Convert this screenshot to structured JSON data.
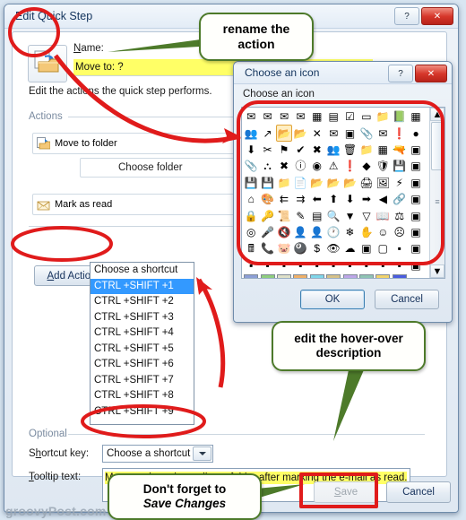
{
  "main_dialog": {
    "title": "Edit Quick Step",
    "help_button": "?",
    "close_button": "✕",
    "name_label": "Name:",
    "name_value": "Move to: ?",
    "description": "Edit the actions the quick step performs.",
    "actions_group": "Actions",
    "actions": [
      {
        "label": "Move to folder",
        "icon": "move-to-folder-icon",
        "sub_label": "Choose folder"
      },
      {
        "label": "Mark as read",
        "icon": "mark-as-read-icon"
      }
    ],
    "add_action_label": "Add Action",
    "optional_group": "Optional",
    "shortcut_label": "Shortcut key:",
    "shortcut_value": "Choose a shortcut",
    "tooltip_label": "Tooltip text:",
    "tooltip_value": "Moves selected e-mail to a folder after marking the e-mail as read.",
    "save_label": "Save",
    "save_disabled": true,
    "cancel_label": "Cancel"
  },
  "shortcut_dropdown": {
    "options": [
      "Choose a shortcut",
      "CTRL +SHIFT +1",
      "CTRL +SHIFT +2",
      "CTRL +SHIFT +3",
      "CTRL +SHIFT +4",
      "CTRL +SHIFT +5",
      "CTRL +SHIFT +6",
      "CTRL +SHIFT +7",
      "CTRL +SHIFT +8",
      "CTRL +SHIFT +9"
    ],
    "selected": "CTRL +SHIFT +1",
    "selected_index": 1,
    "highlight_color": "#3399ff"
  },
  "icon_dialog": {
    "title": "Choose an icon",
    "help_button": "?",
    "close_button": "✕",
    "prompt": "Choose an icon",
    "ok_label": "OK",
    "cancel_label": "Cancel",
    "selected_index": 13,
    "columns": 11,
    "icons": [
      "✉",
      "✉",
      "✉",
      "✉",
      "▦",
      "▤",
      "☑",
      "▭",
      "📁",
      "📗",
      "▦",
      "👥",
      "↗",
      "📂",
      "📂",
      "✕",
      "✉",
      "▣",
      "📎",
      "✉",
      "❗",
      "●",
      "⬇",
      "✂",
      "⚑",
      "✔",
      "✖",
      "👥",
      "🗑",
      "📁",
      "▦",
      "🔫",
      "▣",
      "📎",
      "⛬",
      "✖",
      "ⓘ",
      "◉",
      "⚠",
      "❗",
      "◆",
      "🛡",
      "💾",
      "▣",
      "💾",
      "💾",
      "📁",
      "📄",
      "📂",
      "📂",
      "📂",
      "🖨",
      "🖼",
      "⚡",
      "▣",
      "⌂",
      "🎨",
      "⇇",
      "⇉",
      "⬅",
      "⬆",
      "⬇",
      "➡",
      "◀",
      "🔗",
      "▣",
      "🔒",
      "🔑",
      "📜",
      "✎",
      "▤",
      "🔍",
      "▼",
      "▽",
      "📖",
      "⚖",
      "▣",
      "◎",
      "🎤",
      "🔇",
      "👤",
      "👤",
      "🕐",
      "❄",
      "✋",
      "☺",
      "☹",
      "▣",
      "🖩",
      "📞",
      "🐷",
      "🎱",
      "$",
      "👁",
      "☁",
      "▣",
      "▢",
      "▪",
      "▣",
      "▪",
      "▪",
      "▪",
      "▪",
      "▪",
      "▪",
      "▪",
      "▪",
      "▪",
      "▪",
      "▣"
    ],
    "palette_row": [
      "#8c9fd6",
      "#8fce7e",
      "#dfe0c8",
      "#f0b068",
      "#7fd6ea",
      "#d6c188",
      "#bda6e8",
      "#8fc4b4",
      "#f2d36b",
      "#4a5ce0"
    ]
  },
  "annotations": {
    "rename_callout": "rename the action",
    "rename_callout_l1": "rename the",
    "rename_callout_l2": "action",
    "hover_callout_l1": "edit the hover-over",
    "hover_callout_l2": "description",
    "save_callout_l1": "Don't forget to",
    "save_callout_l2": "Save Changes",
    "circle_color": "#e01b1b",
    "bubble_border_color": "#4d7a2a"
  },
  "watermark": "groovyPost.com"
}
